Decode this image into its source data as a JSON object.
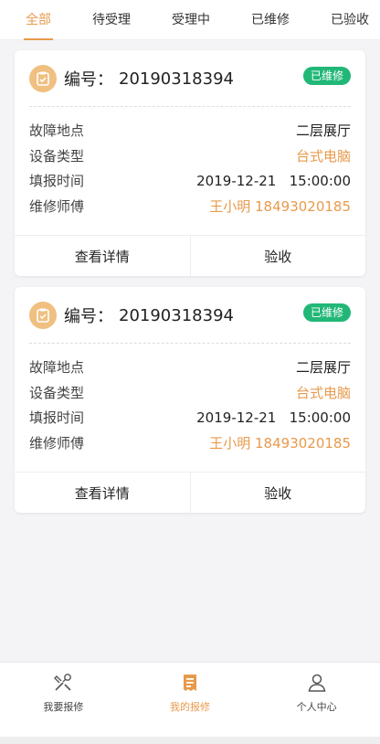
{
  "tabs": [
    {
      "label": "全部",
      "active": true
    },
    {
      "label": "待受理",
      "active": false
    },
    {
      "label": "受理中",
      "active": false
    },
    {
      "label": "已维修",
      "active": false
    },
    {
      "label": "已验收",
      "active": false
    }
  ],
  "cards": [
    {
      "code_label": "编号：",
      "code": "20190318394",
      "status": "已维修",
      "fields": [
        {
          "key": "故障地点",
          "value": "二层展厅"
        },
        {
          "key": "设备类型",
          "value": "台式电脑"
        },
        {
          "key": "填报时间",
          "value": "2019-12-21   15:00:00"
        },
        {
          "key": "维修师傅",
          "value": "王小明 18493020185"
        }
      ],
      "actions": {
        "detail": "查看详情",
        "accept": "验收"
      }
    },
    {
      "code_label": "编号：",
      "code": "20190318394",
      "status": "已维修",
      "fields": [
        {
          "key": "故障地点",
          "value": "二层展厅"
        },
        {
          "key": "设备类型",
          "value": "台式电脑"
        },
        {
          "key": "填报时间",
          "value": "2019-12-21   15:00:00"
        },
        {
          "key": "维修师傅",
          "value": "王小明 18493020185"
        }
      ],
      "actions": {
        "detail": "查看详情",
        "accept": "验收"
      }
    }
  ],
  "bottom_nav": [
    {
      "label": "我要报修",
      "icon": "tools-icon",
      "active": false
    },
    {
      "label": "我的报修",
      "icon": "receipt-icon",
      "active": true
    },
    {
      "label": "个人中心",
      "icon": "user-icon",
      "active": false
    }
  ],
  "colors": {
    "accent": "#e89a4c",
    "status_green": "#21b777",
    "icon_bg": "#f0c081"
  }
}
